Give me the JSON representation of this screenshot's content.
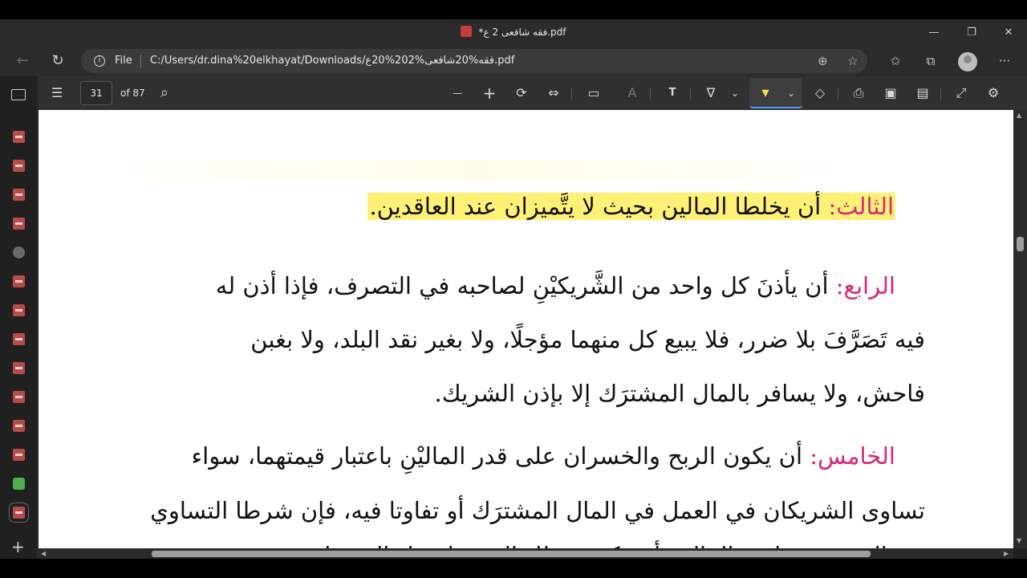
{
  "window": {
    "title": "*فقه شافعى 2 ع.pdf",
    "minimize": "—",
    "maximize": "❐",
    "close": "✕"
  },
  "nav": {
    "back_icon": "←",
    "reload_icon": "↻",
    "file_label": "File",
    "url": "C:/Users/dr.dina%20elkhayat/Downloads/فقه%20شافعى%202%20ع.pdf",
    "zoom_icon": "⊕",
    "favorite_icon": "☆",
    "favorites_icon": "✩",
    "collections_icon": "⧉",
    "menu_icon": "···"
  },
  "pdf_toolbar": {
    "contents_icon": "☰",
    "page_number": "31",
    "page_of": "of 87",
    "search_icon": "⌕",
    "zoom_out": "—",
    "zoom_in": "+",
    "rotate_icon": "⟳",
    "fit_icon": "⇔",
    "page_view_icon": "▭",
    "read_aloud_icon": "A",
    "text_icon": "T",
    "draw_icon": "∇",
    "dropdown": "⌄",
    "highlight_icon": "▾",
    "erase_icon": "◇",
    "print_icon": "⎙",
    "save_icon": "▣",
    "save_as_icon": "▤",
    "expand_icon": "⤢",
    "settings_icon": "⚙"
  },
  "document": {
    "lines": [
      {
        "label": "الثالث:",
        "text": "أن يخلطا المالين بحيث لا يتَّميزان عند العاقدين."
      },
      {
        "label": "الرابع:",
        "text": "أن يأذنَ كل واحد من الشَّريكيْنِ لصاحبه في التصرف، فإذا أذن له"
      },
      {
        "text": "فيه تَصَرَّفَ بلا ضرر، فلا يبيع كل منهما مؤجلًا، ولا بغير نقد البلد، ولا بغبن"
      },
      {
        "text": "فاحش، ولا يسافر بالمال المشترَك إلا بإذن الشريك."
      },
      {
        "label": "الخامس:",
        "text": "أن يكون الربح والخسران على قدر الماليْنِ باعتبار قيمتهما، سواء"
      },
      {
        "text": "تساوى الشريكان في العمل في المال المشترَك أو تفاوتا فيه، فإن شرطا التساوي"
      },
      {
        "text": "في الربح مع تفاوت المالين أو عكسه بطل العقد؛ لفساد الشرط"
      }
    ]
  },
  "colors": {
    "label": "#d6267a",
    "highlight": "#fff176",
    "accent": "#4a9eff"
  }
}
